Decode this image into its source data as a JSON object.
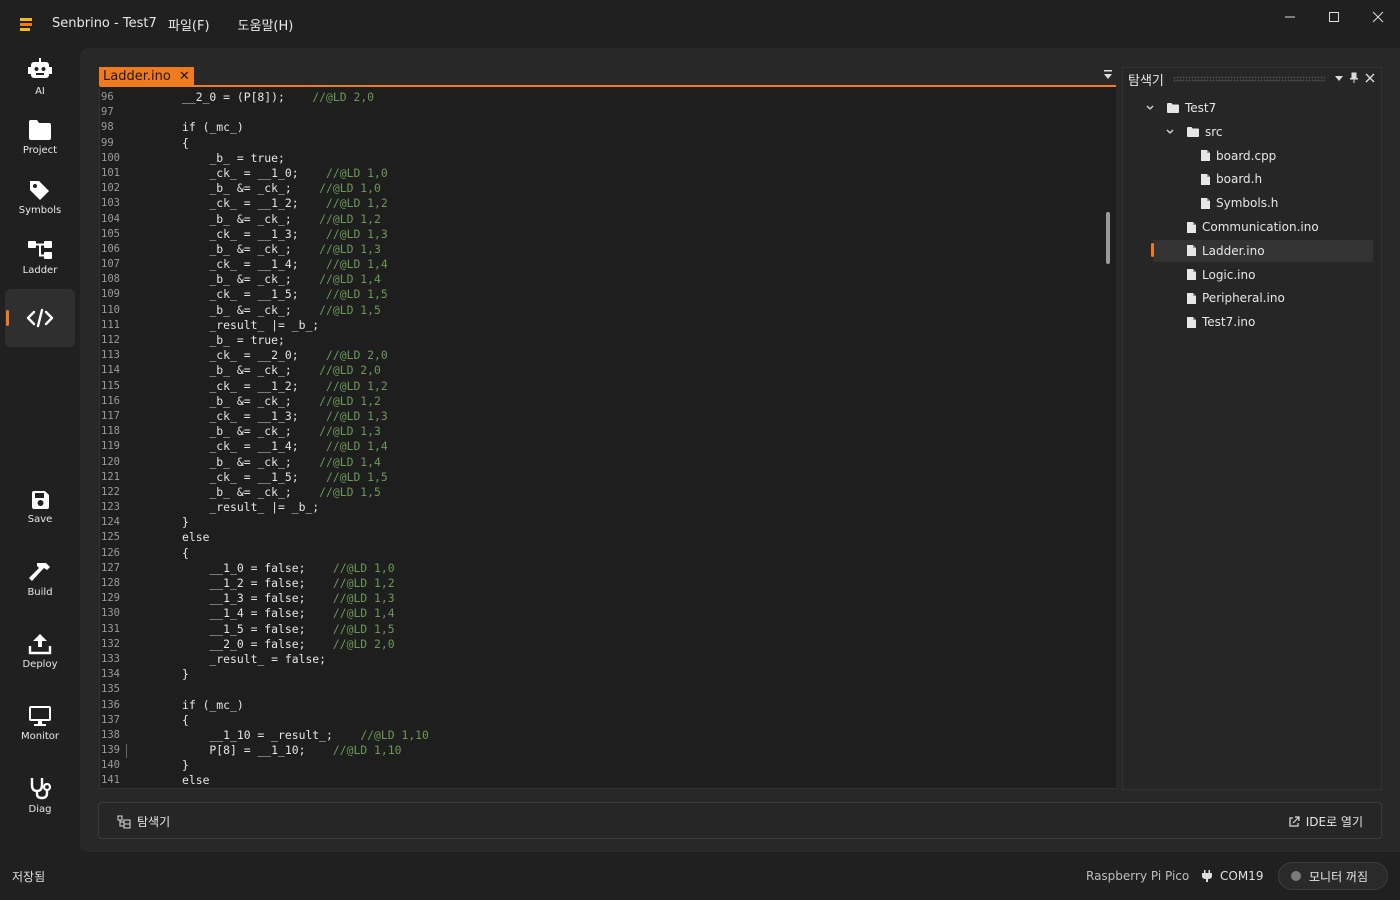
{
  "app": {
    "title": "Senbrino - Test7",
    "menu": [
      "파일(F)",
      "도움말(H)"
    ],
    "accent": "#f07b1f"
  },
  "sidebar": {
    "top_items": [
      {
        "label": "AI",
        "icon": "robot-icon"
      },
      {
        "label": "Project",
        "icon": "folder-icon"
      },
      {
        "label": "Symbols",
        "icon": "tag-icon"
      },
      {
        "label": "Ladder",
        "icon": "ladder-icon"
      },
      {
        "label": "",
        "icon": "code-icon",
        "active": true
      }
    ],
    "bottom_items": [
      {
        "label": "Save",
        "icon": "save-icon"
      },
      {
        "label": "Build",
        "icon": "hammer-icon"
      },
      {
        "label": "Deploy",
        "icon": "upload-icon"
      },
      {
        "label": "Monitor",
        "icon": "monitor-icon"
      },
      {
        "label": "Diag",
        "icon": "stethoscope-icon"
      }
    ]
  },
  "editor": {
    "tab_label": "Ladder.ino",
    "lines": [
      {
        "n": "96",
        "code": "__2_0 = (P[8]);    ",
        "comment": "//@LD 2,0"
      },
      {
        "n": "97",
        "code": "",
        "comment": ""
      },
      {
        "n": "98",
        "code": "if (_mc_)",
        "comment": ""
      },
      {
        "n": "99",
        "code": "{",
        "comment": ""
      },
      {
        "n": "100",
        "code": "    _b_ = true;",
        "comment": ""
      },
      {
        "n": "101",
        "code": "    _ck_ = __1_0;    ",
        "comment": "//@LD 1,0"
      },
      {
        "n": "102",
        "code": "    _b_ &= _ck_;    ",
        "comment": "//@LD 1,0"
      },
      {
        "n": "103",
        "code": "    _ck_ = __1_2;    ",
        "comment": "//@LD 1,2"
      },
      {
        "n": "104",
        "code": "    _b_ &= _ck_;    ",
        "comment": "//@LD 1,2"
      },
      {
        "n": "105",
        "code": "    _ck_ = __1_3;    ",
        "comment": "//@LD 1,3"
      },
      {
        "n": "106",
        "code": "    _b_ &= _ck_;    ",
        "comment": "//@LD 1,3"
      },
      {
        "n": "107",
        "code": "    _ck_ = __1_4;    ",
        "comment": "//@LD 1,4"
      },
      {
        "n": "108",
        "code": "    _b_ &= _ck_;    ",
        "comment": "//@LD 1,4"
      },
      {
        "n": "109",
        "code": "    _ck_ = __1_5;    ",
        "comment": "//@LD 1,5"
      },
      {
        "n": "110",
        "code": "    _b_ &= _ck_;    ",
        "comment": "//@LD 1,5"
      },
      {
        "n": "111",
        "code": "    _result_ |= _b_;",
        "comment": ""
      },
      {
        "n": "112",
        "code": "    _b_ = true;",
        "comment": ""
      },
      {
        "n": "113",
        "code": "    _ck_ = __2_0;    ",
        "comment": "//@LD 2,0"
      },
      {
        "n": "114",
        "code": "    _b_ &= _ck_;    ",
        "comment": "//@LD 2,0"
      },
      {
        "n": "115",
        "code": "    _ck_ = __1_2;    ",
        "comment": "//@LD 1,2"
      },
      {
        "n": "116",
        "code": "    _b_ &= _ck_;    ",
        "comment": "//@LD 1,2"
      },
      {
        "n": "117",
        "code": "    _ck_ = __1_3;    ",
        "comment": "//@LD 1,3"
      },
      {
        "n": "118",
        "code": "    _b_ &= _ck_;    ",
        "comment": "//@LD 1,3"
      },
      {
        "n": "119",
        "code": "    _ck_ = __1_4;    ",
        "comment": "//@LD 1,4"
      },
      {
        "n": "120",
        "code": "    _b_ &= _ck_;    ",
        "comment": "//@LD 1,4"
      },
      {
        "n": "121",
        "code": "    _ck_ = __1_5;    ",
        "comment": "//@LD 1,5"
      },
      {
        "n": "122",
        "code": "    _b_ &= _ck_;    ",
        "comment": "//@LD 1,5"
      },
      {
        "n": "123",
        "code": "    _result_ |= _b_;",
        "comment": ""
      },
      {
        "n": "124",
        "code": "}",
        "comment": ""
      },
      {
        "n": "125",
        "code": "else",
        "comment": ""
      },
      {
        "n": "126",
        "code": "{",
        "comment": ""
      },
      {
        "n": "127",
        "code": "    __1_0 = false;    ",
        "comment": "//@LD 1,0"
      },
      {
        "n": "128",
        "code": "    __1_2 = false;    ",
        "comment": "//@LD 1,2"
      },
      {
        "n": "129",
        "code": "    __1_3 = false;    ",
        "comment": "//@LD 1,3"
      },
      {
        "n": "130",
        "code": "    __1_4 = false;    ",
        "comment": "//@LD 1,4"
      },
      {
        "n": "131",
        "code": "    __1_5 = false;    ",
        "comment": "//@LD 1,5"
      },
      {
        "n": "132",
        "code": "    __2_0 = false;    ",
        "comment": "//@LD 2,0"
      },
      {
        "n": "133",
        "code": "    _result_ = false;",
        "comment": ""
      },
      {
        "n": "134",
        "code": "}",
        "comment": ""
      },
      {
        "n": "135",
        "code": "",
        "comment": ""
      },
      {
        "n": "136",
        "code": "if (_mc_)",
        "comment": ""
      },
      {
        "n": "137",
        "code": "{",
        "comment": ""
      },
      {
        "n": "138",
        "code": "    __1_10 = _result_;    ",
        "comment": "//@LD 1,10"
      },
      {
        "n": "139",
        "code": "    P[8] = __1_10;    ",
        "comment": "//@LD 1,10"
      },
      {
        "n": "140",
        "code": "}",
        "comment": ""
      },
      {
        "n": "141",
        "code": "else",
        "comment": ""
      }
    ]
  },
  "explorer": {
    "title": "탐색기",
    "tree": [
      {
        "label": "Test7",
        "type": "folder",
        "depth": 0,
        "expanded": true
      },
      {
        "label": "src",
        "type": "folder",
        "depth": 1,
        "expanded": true
      },
      {
        "label": "board.cpp",
        "type": "file",
        "depth": 2
      },
      {
        "label": "board.h",
        "type": "file",
        "depth": 2
      },
      {
        "label": "Symbols.h",
        "type": "file",
        "depth": 2
      },
      {
        "label": "Communication.ino",
        "type": "file",
        "depth": 1
      },
      {
        "label": "Ladder.ino",
        "type": "file",
        "depth": 1,
        "selected": true
      },
      {
        "label": "Logic.ino",
        "type": "file",
        "depth": 1
      },
      {
        "label": "Peripheral.ino",
        "type": "file",
        "depth": 1
      },
      {
        "label": "Test7.ino",
        "type": "file",
        "depth": 1
      }
    ]
  },
  "bottom_bar": {
    "left_label": "탐색기",
    "right_label": "IDE로 열기"
  },
  "status": {
    "left": "저장됨",
    "device": "Raspberry Pi Pico",
    "port": "COM19",
    "monitor_toggle": "모니터 꺼짐"
  }
}
